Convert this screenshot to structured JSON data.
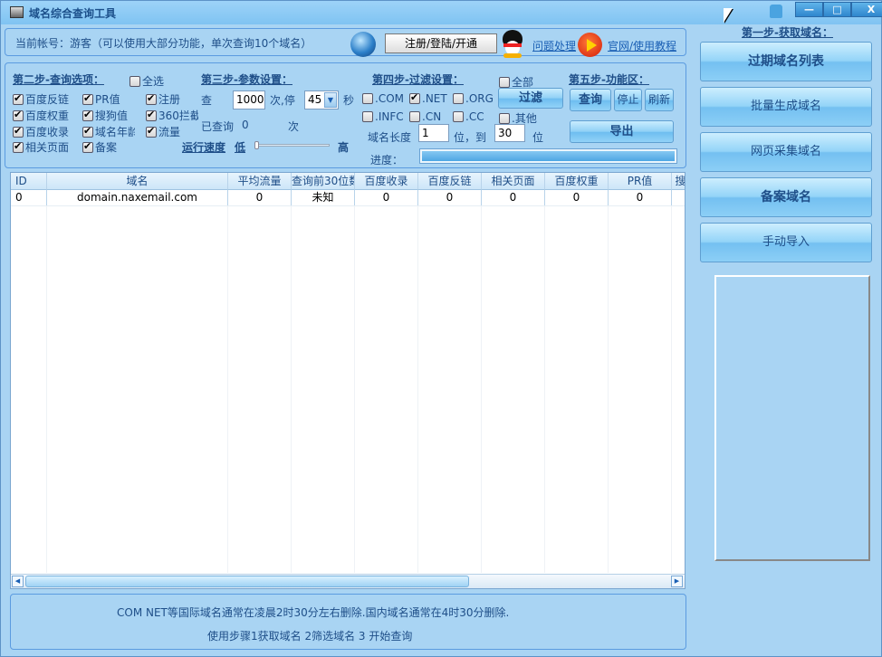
{
  "window": {
    "title": "域名综合查询工具",
    "controls": {
      "minimize": "—",
      "maximize": "□",
      "close": "X"
    }
  },
  "account": {
    "text": "当前帐号：游客（可以使用大部分功能，单次查询10个域名）",
    "register_button": "注册/登陆/开通",
    "help_link": "问题处理",
    "site_link": "官网/使用教程"
  },
  "step2": {
    "title": "第二步-查询选项：",
    "select_all": {
      "label": "全选",
      "checked": false
    },
    "options": [
      {
        "label": "百度反链",
        "checked": true
      },
      {
        "label": "PR值",
        "checked": true
      },
      {
        "label": "注册",
        "checked": true
      },
      {
        "label": "百度权重",
        "checked": true
      },
      {
        "label": "搜狗值",
        "checked": true
      },
      {
        "label": "360拦截",
        "checked": true
      },
      {
        "label": "百度收录",
        "checked": true
      },
      {
        "label": "域名年龄",
        "checked": true
      },
      {
        "label": "流量",
        "checked": true
      },
      {
        "label": "相关页面",
        "checked": true
      },
      {
        "label": "备案",
        "checked": true
      }
    ]
  },
  "step3": {
    "title": "第三步-参数设置：",
    "query_label": "查",
    "query_count": "1000",
    "pause_label": "次,停",
    "pause_value": "45",
    "seconds_label": "秒",
    "queried_label": "已查询",
    "queried_count": "0",
    "times_label": "次",
    "speed_label": "运行速度",
    "speed_low": "低",
    "speed_high": "高",
    "speed_value": 0
  },
  "step4": {
    "title": "第四步-过滤设置：",
    "all": {
      "label": "全部",
      "checked": false
    },
    "tlds": [
      {
        "label": ".COM",
        "checked": false
      },
      {
        "label": ".NET",
        "checked": true
      },
      {
        "label": ".ORG",
        "checked": false
      },
      {
        "label": ".INFC",
        "checked": false
      },
      {
        "label": ".CN",
        "checked": false
      },
      {
        "label": ".CC",
        "checked": false
      },
      {
        "label": ".其他",
        "checked": false
      }
    ],
    "filter_button": "过滤",
    "length_label": "域名长度",
    "length_min": "1",
    "to_label": "位，到",
    "length_max": "30",
    "unit_label": "位",
    "progress_label": "进度：",
    "progress": 1.0
  },
  "step5": {
    "title": "第五步-功能区：",
    "query_button": "查询",
    "stop_button": "停止",
    "refresh_button": "刷新",
    "export_button": "导出"
  },
  "table": {
    "columns": [
      "ID",
      "域名",
      "平均流量",
      "查询前30位数",
      "百度收录",
      "百度反链",
      "相关页面",
      "百度权重",
      "PR值",
      "搜"
    ],
    "rows": [
      [
        "0",
        "domain.naxemail.com",
        "0",
        "未知",
        "0",
        "0",
        "0",
        "0",
        "0",
        ""
      ]
    ]
  },
  "notes": {
    "line1": "COM NET等国际域名通常在凌晨2时30分左右删除.国内域名通常在4时30分删除.",
    "line2": "使用步骤1获取域名 2筛选域名 3 开始查询"
  },
  "step1": {
    "title": "第一步-获取域名：",
    "buttons": [
      "过期域名列表",
      "批量生成域名",
      "网页采集域名",
      "备案域名",
      "手动导入"
    ]
  }
}
